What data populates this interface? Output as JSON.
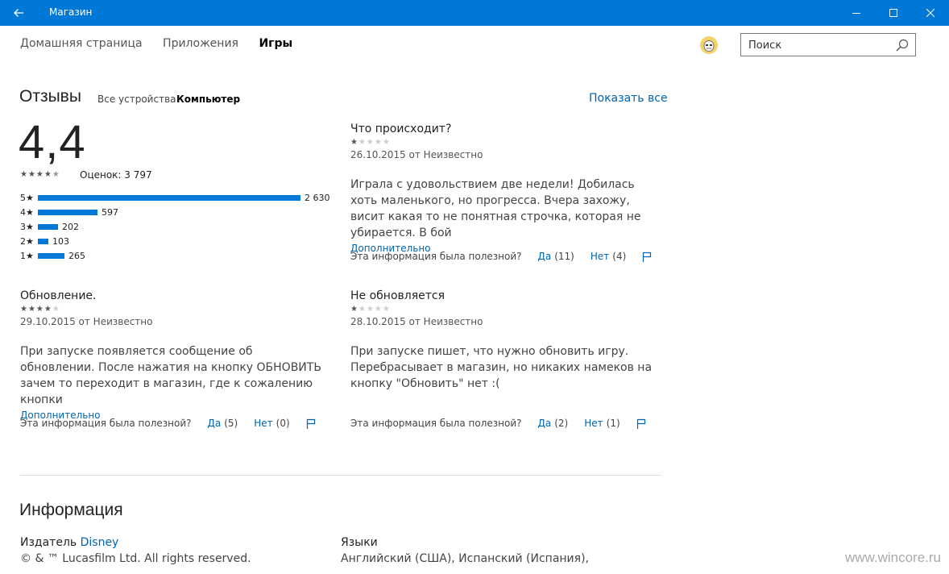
{
  "window": {
    "title": "Магазин"
  },
  "nav": {
    "items": [
      "Домашняя страница",
      "Приложения",
      "Игры"
    ],
    "active_index": 2
  },
  "search": {
    "placeholder": "Поиск"
  },
  "reviews": {
    "title": "Отзывы",
    "tabs": [
      "Все устройства",
      "Компьютер"
    ],
    "active_tab": 1,
    "show_all": "Показать все",
    "rating": "4,4",
    "rating_stars": 4.5,
    "count_label": "Оценок: 3 797",
    "breakdown": [
      {
        "label": "5★",
        "value": 2630,
        "text": "2 630"
      },
      {
        "label": "4★",
        "value": 597,
        "text": "597"
      },
      {
        "label": "3★",
        "value": 202,
        "text": "202"
      },
      {
        "label": "2★",
        "value": 103,
        "text": "103"
      },
      {
        "label": "1★",
        "value": 265,
        "text": "265"
      }
    ],
    "helpful_label": "Эта информация была полезной?",
    "more_label": "Дополнительно",
    "items": [
      {
        "title": "Что происходит?",
        "stars": 1,
        "meta": "26.10.2015 от Неизвестно",
        "body": "Играла с удовольствием две недели! Добилась хоть маленького, но прогресса. Вчера захожу, висит какая то не понятная строчка, которая не убирается. В бой",
        "more": true,
        "yes": "Да",
        "yes_count": "(11)",
        "no": "Нет",
        "no_count": "(4)"
      },
      {
        "title": "Обновление.",
        "stars": 4,
        "meta": "29.10.2015 от Неизвестно",
        "body": "При запуске появляется сообщение об обновлении. После нажатия на кнопку ОБНОВИТЬ зачем то переходит в магазин, где к сожалению кнопки",
        "more": true,
        "yes": "Да",
        "yes_count": "(5)",
        "no": "Нет",
        "no_count": "(0)"
      },
      {
        "title": "Не обновляется",
        "stars": 1,
        "meta": "28.10.2015 от Неизвестно",
        "body": "При запуске пишет, что нужно обновить игру. Перебрасывает в магазин, но никаких намеков на кнопку \"Обновить\" нет :(",
        "more": false,
        "yes": "Да",
        "yes_count": "(2)",
        "no": "Нет",
        "no_count": "(1)"
      }
    ]
  },
  "info": {
    "title": "Информация",
    "publisher_label": "Издатель",
    "publisher": "Disney",
    "copyright": "© & ™ Lucasfilm Ltd.  All rights reserved.",
    "languages_label": "Языки",
    "languages": "Английский (США), Испанский (Испания),"
  },
  "watermark": "www.wincore.ru",
  "icons": [
    "back-arrow-icon",
    "minimize-icon",
    "maximize-icon",
    "close-icon",
    "search-icon",
    "flag-icon",
    "avatar-icon"
  ],
  "colors": {
    "accent": "#0078d7",
    "link": "#0063b1"
  }
}
